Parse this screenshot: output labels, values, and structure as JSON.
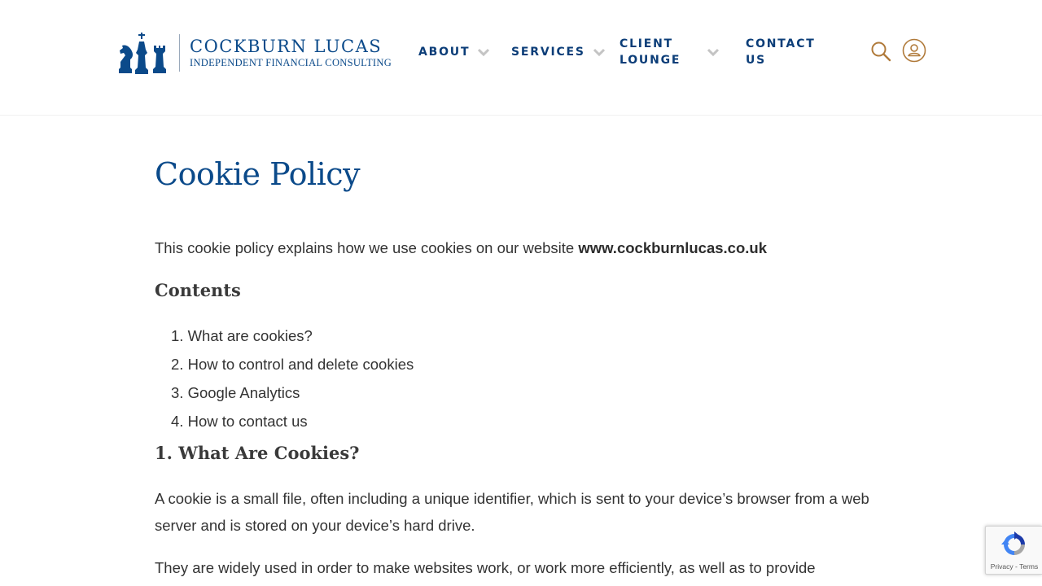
{
  "brand": {
    "name": "COCKBURN LUCAS",
    "tagline": "INDEPENDENT FINANCIAL CONSULTING",
    "primary_color": "#0b4a8a",
    "accent_color": "#b07a3a"
  },
  "nav": {
    "items": [
      {
        "label": "ABOUT",
        "has_dropdown": true
      },
      {
        "label": "SERVICES",
        "has_dropdown": true
      },
      {
        "label": "CLIENT LOUNGE",
        "has_dropdown": true
      },
      {
        "label": "CONTACT US",
        "has_dropdown": false
      }
    ],
    "search_icon": "search-icon",
    "account_icon": "user-icon"
  },
  "main": {
    "title": "Cookie Policy",
    "intro_text": "This cookie policy explains how we use cookies on our website ",
    "intro_link": "www.cockburnlucas.co.uk",
    "contents_heading": "Contents",
    "toc": [
      {
        "num": "1.",
        "label": "What are cookies?"
      },
      {
        "num": "2.",
        "label": "How to control and delete cookies"
      },
      {
        "num": "3.",
        "label": "Google Analytics"
      },
      {
        "num": "4.",
        "label": "How to contact us"
      }
    ],
    "section1_heading": "1. What Are Cookies?",
    "section1_p1": "A cookie is a small file, often including a unique identifier, which is sent to your device’s browser from a web server and is stored on your device’s hard drive.",
    "section1_p2": "They are widely used in order to make websites work, or work more efficiently, as well as to provide"
  },
  "recaptcha": {
    "links": "Privacy - Terms"
  }
}
